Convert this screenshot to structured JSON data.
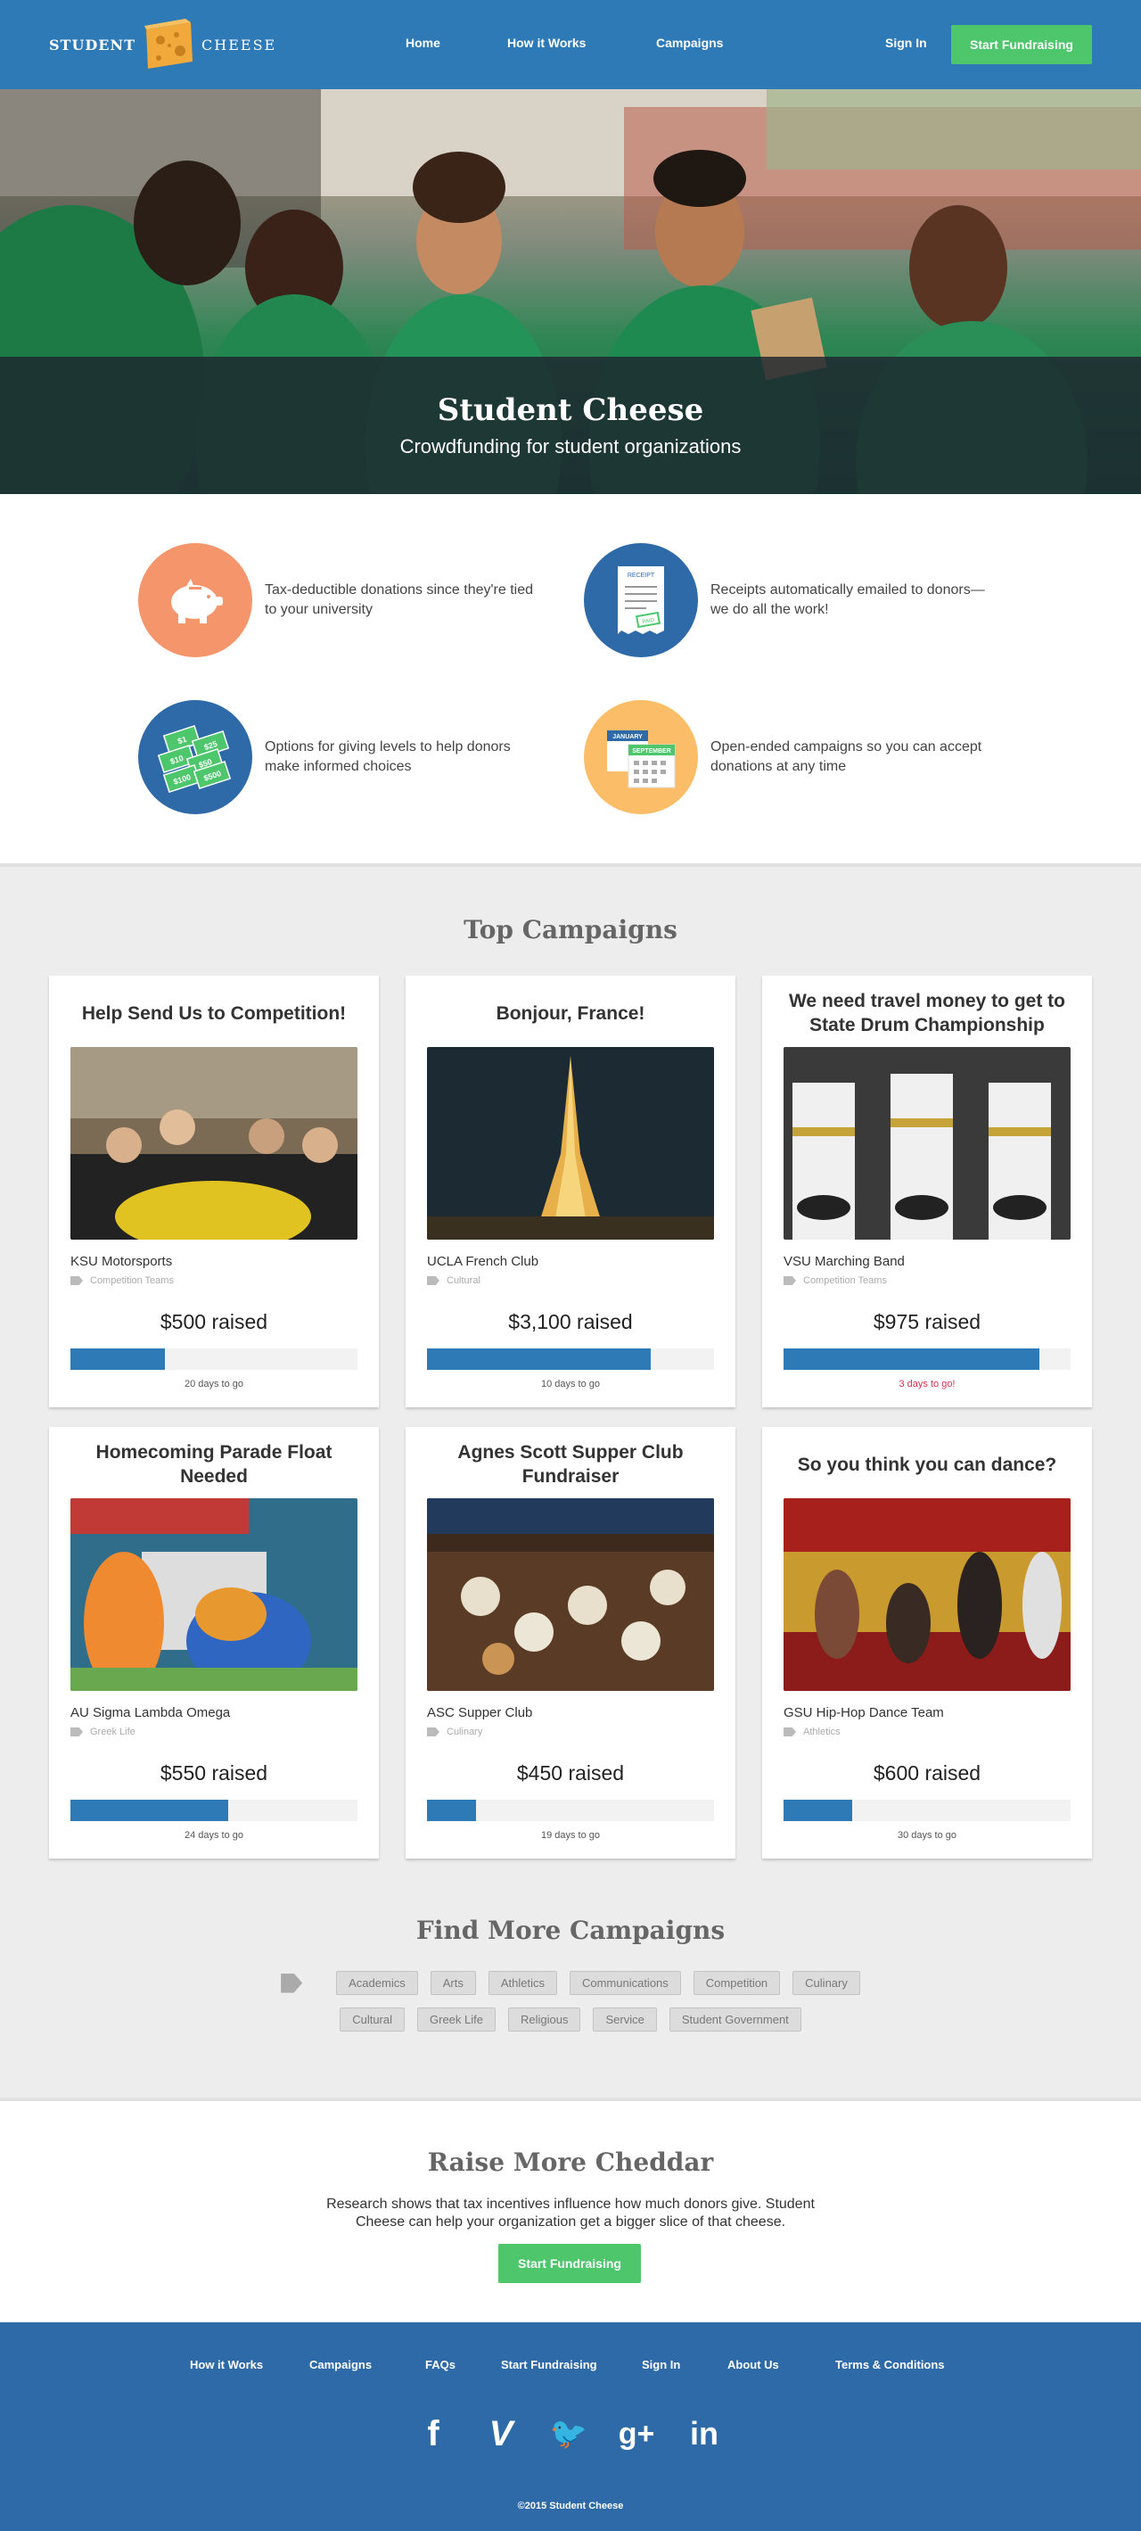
{
  "nav": {
    "logo_left": "STUDENT",
    "logo_right": "CHEESE",
    "links": [
      "Home",
      "How it Works",
      "Campaigns"
    ],
    "sign_in": "Sign In",
    "cta": "Start Fundraising"
  },
  "hero": {
    "title": "Student Cheese",
    "subtitle": "Crowdfunding for student organizations"
  },
  "features": [
    {
      "icon": "piggy-bank-icon",
      "color": "#f5956b",
      "text": "Tax-deductible donations since they're tied to your university"
    },
    {
      "icon": "receipt-icon",
      "color": "#2e6aa8",
      "text": "Receipts automatically emailed to donors—we do all the work!",
      "receipt_label": "RECEIPT",
      "paid_label": "PAID"
    },
    {
      "icon": "money-bills-icon",
      "color": "#2e6aa8",
      "text": "Options for giving levels to help donors make informed choices",
      "bills": [
        "$1",
        "$25",
        "$10",
        "$50",
        "$100",
        "$500"
      ]
    },
    {
      "icon": "calendar-icon",
      "color": "#fbbd68",
      "text": "Open-ended campaigns so you can accept donations at any time",
      "month1": "JANUARY",
      "month2": "SEPTEMBER"
    }
  ],
  "top_campaigns": {
    "title": "Top Campaigns",
    "cards": [
      {
        "title": "Help Send Us to Competition!",
        "org": "KSU Motorsports",
        "category": "Competition Teams",
        "raised": "$500 raised",
        "progress": 0.33,
        "days": "20 days to go",
        "urgent": false
      },
      {
        "title": "Bonjour, France!",
        "org": "UCLA French Club",
        "category": "Cultural",
        "raised": "$3,100 raised",
        "progress": 0.78,
        "days": "10 days to go",
        "urgent": false
      },
      {
        "title": "We need travel money to get to State Drum Championship",
        "org": "VSU Marching Band",
        "category": "Competition Teams",
        "raised": "$975 raised",
        "progress": 0.89,
        "days": "3 days to go!",
        "urgent": true
      },
      {
        "title": "Homecoming Parade Float Needed",
        "org": "AU Sigma Lambda Omega",
        "category": "Greek Life",
        "raised": "$550 raised",
        "progress": 0.55,
        "days": "24 days to go",
        "urgent": false
      },
      {
        "title": "Agnes Scott Supper Club Fundraiser",
        "org": "ASC Supper Club",
        "category": "Culinary",
        "raised": "$450 raised",
        "progress": 0.17,
        "days": "19 days to go",
        "urgent": false
      },
      {
        "title": "So you think you can dance?",
        "org": "GSU Hip-Hop Dance Team",
        "category": "Athletics",
        "raised": "$600 raised",
        "progress": 0.24,
        "days": "30 days to go",
        "urgent": false
      }
    ]
  },
  "find_more": {
    "title": "Find More Campaigns",
    "row1": [
      "Academics",
      "Arts",
      "Athletics",
      "Communications",
      "Competition",
      "Culinary"
    ],
    "row2": [
      "Cultural",
      "Greek Life",
      "Religious",
      "Service",
      "Student Government"
    ]
  },
  "raise": {
    "title": "Raise More Cheddar",
    "line1": "Research shows that tax incentives influence how much donors give. Student",
    "line2": "Cheese can help your organization get a bigger slice of that cheese.",
    "cta": "Start Fundraising"
  },
  "footer": {
    "links": [
      "How it Works",
      "Campaigns",
      "FAQs",
      "Start Fundraising",
      "Sign In",
      "About Us",
      "Terms & Conditions"
    ],
    "social": [
      {
        "icon": "facebook-icon",
        "glyph": "f"
      },
      {
        "icon": "vimeo-icon",
        "glyph": "V"
      },
      {
        "icon": "twitter-icon",
        "glyph": "🐦"
      },
      {
        "icon": "google-plus-icon",
        "glyph": "g+"
      },
      {
        "icon": "linkedin-icon",
        "glyph": "in"
      }
    ],
    "copyright": "©2015 Student Cheese"
  }
}
